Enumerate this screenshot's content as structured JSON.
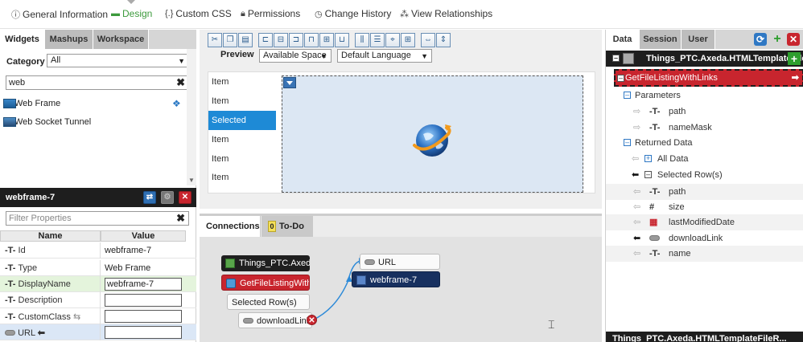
{
  "top_tabs": [
    {
      "label": "General Information",
      "icon": "info-icon"
    },
    {
      "label": "Design",
      "icon": "design-icon",
      "active": true
    },
    {
      "label": "Custom CSS",
      "icon": "css-braces-icon"
    },
    {
      "label": "Permissions",
      "icon": "lock-icon"
    },
    {
      "label": "Change History",
      "icon": "clock-icon"
    },
    {
      "label": "View Relationships",
      "icon": "relationships-icon"
    }
  ],
  "left": {
    "tabs": [
      "Widgets",
      "Mashups",
      "Workspace"
    ],
    "category_label": "Category",
    "category_value": "All",
    "search_value": "web",
    "widgets": [
      "Web Frame",
      "Web Socket Tunnel"
    ]
  },
  "props": {
    "title": "webframe-7",
    "filter_placeholder": "Filter Properties",
    "col_name": "Name",
    "col_value": "Value",
    "rows": [
      {
        "name": "Id",
        "value": "webframe-7"
      },
      {
        "name": "Type",
        "value": "Web Frame"
      },
      {
        "name": "DisplayName",
        "value": "webframe-7"
      },
      {
        "name": "Description",
        "value": ""
      },
      {
        "name": "CustomClass",
        "value": ""
      },
      {
        "name": "URL",
        "value": ""
      }
    ]
  },
  "center": {
    "preview_label": "Preview",
    "space_select": "Available Space",
    "language_select": "Default Language",
    "items": [
      "Item",
      "Item",
      "Selected",
      "Item",
      "Item",
      "Item"
    ]
  },
  "connections": {
    "tab_label": "Connections",
    "todo_count": "0",
    "todo_label": "To-Do",
    "thing_node": "Things_PTC.Axeda....",
    "service_node": "GetFileListingWith...",
    "selected_rows": "Selected Row(s)",
    "download_link": "downloadLink",
    "url_label": "URL",
    "target_widget": "webframe-7"
  },
  "right": {
    "tabs": [
      "Data",
      "Session",
      "User"
    ],
    "thing_name": "Things_PTC.Axeda.HTMLTemplateFile...",
    "service_name": "GetFileListingWithLinks",
    "parameters_label": "Parameters",
    "params": [
      "path",
      "nameMask"
    ],
    "returned_label": "Returned Data",
    "all_data": "All Data",
    "selected_rows": "Selected Row(s)",
    "fields": [
      "path",
      "size",
      "lastModifiedDate",
      "downloadLink",
      "name"
    ],
    "footer_thing": "Things_PTC.Axeda.HTMLTemplateFileR..."
  }
}
